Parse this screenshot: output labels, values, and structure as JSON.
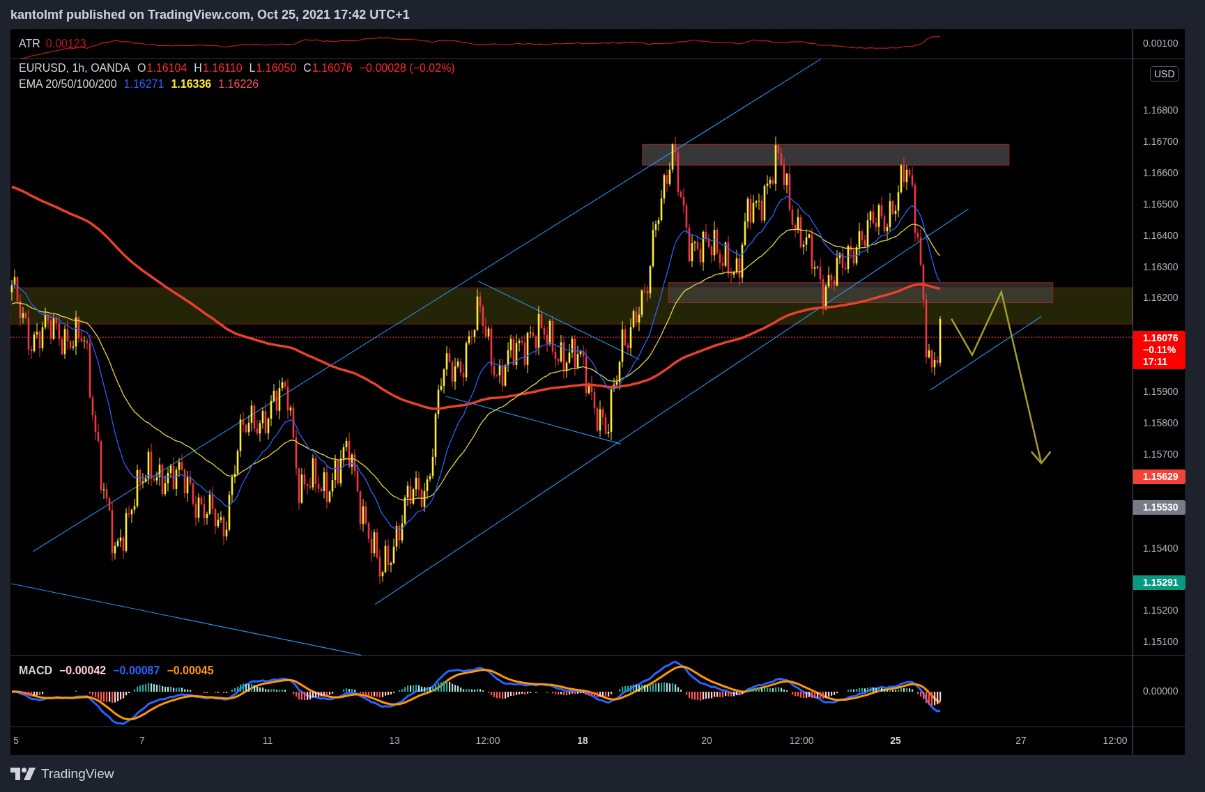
{
  "header": {
    "text": "kantolmf published on TradingView.com, Oct 25, 2021 17:42 UTC+1"
  },
  "atr": {
    "label": "ATR",
    "value": "0.00123",
    "axis_label": "0.00100"
  },
  "legend": {
    "symbol": "EURUSD, 1h, OANDA",
    "ohlc": [
      {
        "key": "O",
        "value": "1.16104"
      },
      {
        "key": "H",
        "value": "1.16110"
      },
      {
        "key": "L",
        "value": "1.16050"
      },
      {
        "key": "C",
        "value": "1.16076"
      }
    ],
    "change": "−0.00028 (−0.02%)"
  },
  "ema": {
    "label": "EMA 20/50/100/200",
    "values": [
      {
        "value": "1.16271",
        "color": "#2962ff"
      },
      {
        "value": "1.16336",
        "color": "#ffeb3b"
      },
      {
        "value": "1.16226",
        "color": "#f7525f"
      }
    ]
  },
  "currency_button": "USD",
  "price_axis": {
    "ticks": [
      "1.16800",
      "1.16700",
      "1.16600",
      "1.16500",
      "1.16400",
      "1.16300",
      "1.16200",
      "1.15900",
      "1.15800",
      "1.15700",
      "1.15400",
      "1.15200",
      "1.15100"
    ]
  },
  "price_tags": [
    {
      "lines": [
        "1.16076",
        "−0.11%",
        "17:11"
      ],
      "color": "#ff0000"
    },
    {
      "lines": [
        "1.15629"
      ],
      "color": "#f44336"
    },
    {
      "lines": [
        "1.15530"
      ],
      "color": "#787b86"
    },
    {
      "lines": [
        "1.15291"
      ],
      "color": "#089981"
    }
  ],
  "macd": {
    "label": "MACD",
    "values": [
      {
        "value": "−0.00042",
        "color": "#ffcdd2"
      },
      {
        "value": "−0.00087",
        "color": "#2962ff"
      },
      {
        "value": "−0.00045",
        "color": "#ff9800"
      }
    ],
    "axis_label": "0.00000"
  },
  "time_axis": [
    {
      "label": "5",
      "major": false
    },
    {
      "label": "7",
      "major": false
    },
    {
      "label": "11",
      "major": false
    },
    {
      "label": "13",
      "major": false
    },
    {
      "label": "12:00",
      "major": false
    },
    {
      "label": "18",
      "major": true
    },
    {
      "label": "20",
      "major": false
    },
    {
      "label": "12:00",
      "major": false
    },
    {
      "label": "25",
      "major": true
    },
    {
      "label": "27",
      "major": false
    },
    {
      "label": "12:00",
      "major": false
    }
  ],
  "footer": {
    "brand": "TradingView"
  }
}
